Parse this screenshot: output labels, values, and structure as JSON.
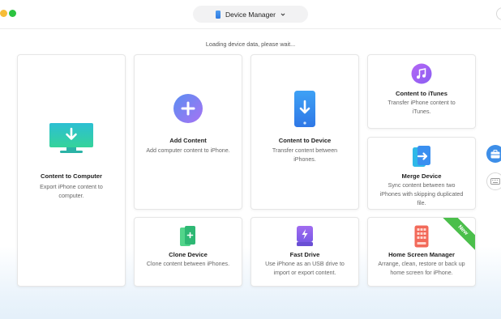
{
  "header": {
    "device_selector_label": "Device Manager"
  },
  "status": {
    "loading_text": "Loading device data, please wait..."
  },
  "cards": {
    "content_to_computer": {
      "title": "Content to Computer",
      "desc": "Export iPhone content to computer."
    },
    "add_content": {
      "title": "Add Content",
      "desc": "Add computer content to iPhone."
    },
    "content_to_device": {
      "title": "Content to Device",
      "desc": "Transfer content between iPhones."
    },
    "content_to_itunes": {
      "title": "Content to iTunes",
      "desc": "Transfer iPhone content to iTunes."
    },
    "merge_device": {
      "title": "Merge Device",
      "desc": "Sync content between two iPhones with skipping duplicated file."
    },
    "clone_device": {
      "title": "Clone Device",
      "desc": "Clone content between iPhones."
    },
    "fast_drive": {
      "title": "Fast Drive",
      "desc": "Use iPhone as an USB drive to import or export content."
    },
    "home_screen_manager": {
      "title": "Home Screen Manager",
      "desc": "Arrange, clean, restore or back up home screen for iPhone.",
      "badge": "New"
    }
  },
  "colors": {
    "accent_blue": "#3d8ee8",
    "new_badge_green": "#4bbf4b",
    "itunes_purple": "#a25ff0",
    "fast_drive_purple": "#8c63e6",
    "home_screen_red": "#f26a5a",
    "clone_green": "#3cc47a",
    "computer_teal": "#2fc4c4"
  },
  "icons": {
    "device_selector": "phone-icon",
    "dropdown": "chevron-down-icon",
    "content_to_computer": "monitor-download-icon",
    "add_content": "plus-circle-icon",
    "content_to_device": "phone-download-icon",
    "content_to_itunes": "music-note-icon",
    "merge_device": "merge-arrow-icon",
    "clone_device": "clone-phones-icon",
    "fast_drive": "usb-drive-icon",
    "home_screen_manager": "app-grid-phone-icon",
    "side_toolbox": "toolbox-icon",
    "side_keyboard": "keyboard-icon"
  }
}
